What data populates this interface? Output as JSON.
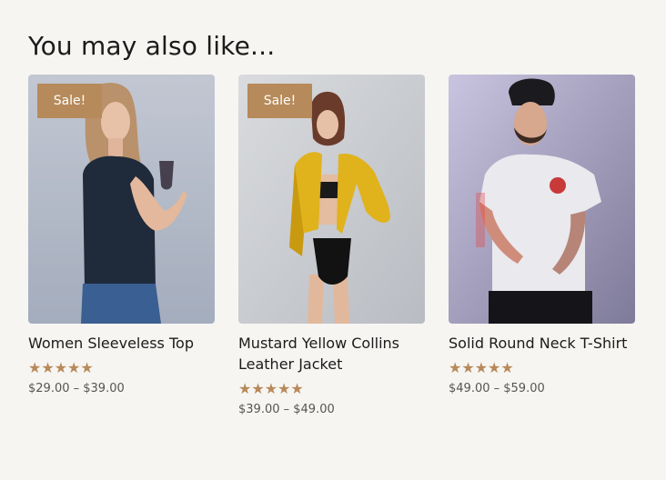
{
  "section": {
    "heading": "You may also like..."
  },
  "products": [
    {
      "title": "Women Sleeveless Top",
      "badge": "Sale!",
      "stars": "★★★★★",
      "rating": 5,
      "price": "$29.00 – $39.00"
    },
    {
      "title": "Mustard Yellow Collins Leather Jacket",
      "badge": "Sale!",
      "stars": "★★★★★",
      "rating": 5,
      "price": "$39.00 – $49.00"
    },
    {
      "title": "Solid Round Neck T-Shirt",
      "stars": "★★★★★",
      "rating": 5,
      "price": "$49.00 – $59.00"
    }
  ],
  "colors": {
    "background": "#f6f5f2",
    "accent": "#b68a5a",
    "star": "#b8895a"
  }
}
